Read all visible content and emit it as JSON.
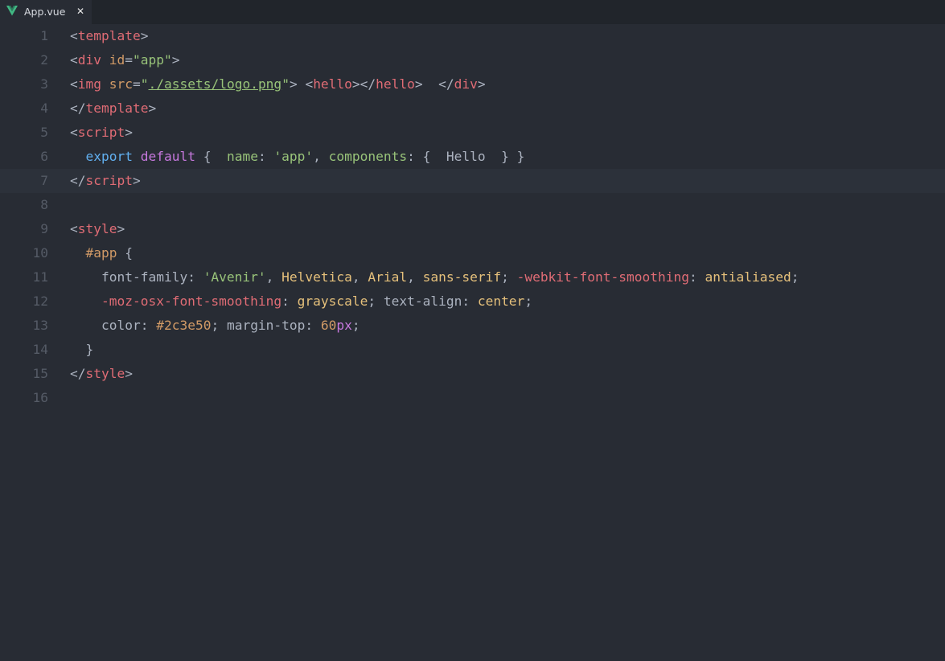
{
  "tab": {
    "title": "App.vue",
    "close_label": "✕",
    "icon": "vue-icon",
    "icon_color": "#41b883"
  },
  "editor": {
    "active_line": 7,
    "lines": [
      {
        "number": "1",
        "tokens": [
          {
            "t": "<",
            "c": "punct"
          },
          {
            "t": "template",
            "c": "tag"
          },
          {
            "t": ">",
            "c": "punct"
          }
        ]
      },
      {
        "number": "2",
        "tokens": [
          {
            "t": "<",
            "c": "punct"
          },
          {
            "t": "div",
            "c": "tag"
          },
          {
            "t": " ",
            "c": "plain"
          },
          {
            "t": "id",
            "c": "attr"
          },
          {
            "t": "=",
            "c": "punct"
          },
          {
            "t": "\"app\"",
            "c": "string"
          },
          {
            "t": ">",
            "c": "punct"
          }
        ]
      },
      {
        "number": "3",
        "tokens": [
          {
            "t": "<",
            "c": "punct"
          },
          {
            "t": "img",
            "c": "tag"
          },
          {
            "t": " ",
            "c": "plain"
          },
          {
            "t": "src",
            "c": "attr"
          },
          {
            "t": "=",
            "c": "punct"
          },
          {
            "t": "\"",
            "c": "string"
          },
          {
            "t": "./assets/logo.png",
            "c": "url"
          },
          {
            "t": "\"",
            "c": "string"
          },
          {
            "t": "> ",
            "c": "punct"
          },
          {
            "t": "<",
            "c": "punct"
          },
          {
            "t": "hello",
            "c": "tag"
          },
          {
            "t": "></",
            "c": "punct"
          },
          {
            "t": "hello",
            "c": "tag"
          },
          {
            "t": ">  </",
            "c": "punct"
          },
          {
            "t": "div",
            "c": "tag"
          },
          {
            "t": ">",
            "c": "punct"
          }
        ]
      },
      {
        "number": "4",
        "tokens": [
          {
            "t": "</",
            "c": "punct"
          },
          {
            "t": "template",
            "c": "tag"
          },
          {
            "t": ">",
            "c": "punct"
          }
        ]
      },
      {
        "number": "5",
        "tokens": [
          {
            "t": "<",
            "c": "punct"
          },
          {
            "t": "script",
            "c": "tag"
          },
          {
            "t": ">",
            "c": "punct"
          }
        ]
      },
      {
        "number": "6",
        "tokens": [
          {
            "t": "  ",
            "c": "plain"
          },
          {
            "t": "export",
            "c": "export"
          },
          {
            "t": " ",
            "c": "plain"
          },
          {
            "t": "default",
            "c": "keyword"
          },
          {
            "t": " {  ",
            "c": "plain"
          },
          {
            "t": "name",
            "c": "prop"
          },
          {
            "t": ": ",
            "c": "plain"
          },
          {
            "t": "'app'",
            "c": "string"
          },
          {
            "t": ", ",
            "c": "plain"
          },
          {
            "t": "components",
            "c": "prop"
          },
          {
            "t": ": {  Hello  } }",
            "c": "plain"
          }
        ]
      },
      {
        "number": "7",
        "tokens": [
          {
            "t": "</",
            "c": "punct"
          },
          {
            "t": "script",
            "c": "tag"
          },
          {
            "t": ">",
            "c": "punct"
          }
        ]
      },
      {
        "number": "8",
        "tokens": []
      },
      {
        "number": "9",
        "tokens": [
          {
            "t": "<",
            "c": "punct"
          },
          {
            "t": "style",
            "c": "tag"
          },
          {
            "t": ">",
            "c": "punct"
          }
        ]
      },
      {
        "number": "10",
        "tokens": [
          {
            "t": "  ",
            "c": "plain"
          },
          {
            "t": "#app",
            "c": "selector"
          },
          {
            "t": " {",
            "c": "plain"
          }
        ]
      },
      {
        "number": "11",
        "tokens": [
          {
            "t": "    ",
            "c": "plain"
          },
          {
            "t": "font-family",
            "c": "cssprop"
          },
          {
            "t": ": ",
            "c": "plain"
          },
          {
            "t": "'Avenir'",
            "c": "string"
          },
          {
            "t": ", ",
            "c": "plain"
          },
          {
            "t": "Helvetica",
            "c": "value"
          },
          {
            "t": ", ",
            "c": "plain"
          },
          {
            "t": "Arial",
            "c": "value"
          },
          {
            "t": ", ",
            "c": "plain"
          },
          {
            "t": "sans-serif",
            "c": "value"
          },
          {
            "t": "; ",
            "c": "plain"
          },
          {
            "t": "-webkit-font-smoothing",
            "c": "vendor"
          },
          {
            "t": ": ",
            "c": "plain"
          },
          {
            "t": "antialiased",
            "c": "value"
          },
          {
            "t": ";",
            "c": "plain"
          }
        ]
      },
      {
        "number": "12",
        "tokens": [
          {
            "t": "    ",
            "c": "plain"
          },
          {
            "t": "-moz-osx-font-smoothing",
            "c": "vendor"
          },
          {
            "t": ": ",
            "c": "plain"
          },
          {
            "t": "grayscale",
            "c": "value"
          },
          {
            "t": "; ",
            "c": "plain"
          },
          {
            "t": "text-align",
            "c": "cssprop"
          },
          {
            "t": ": ",
            "c": "plain"
          },
          {
            "t": "center",
            "c": "value"
          },
          {
            "t": ";",
            "c": "plain"
          }
        ]
      },
      {
        "number": "13",
        "tokens": [
          {
            "t": "    ",
            "c": "plain"
          },
          {
            "t": "color",
            "c": "cssprop"
          },
          {
            "t": ": ",
            "c": "plain"
          },
          {
            "t": "#2c3e50",
            "c": "hex"
          },
          {
            "t": "; ",
            "c": "plain"
          },
          {
            "t": "margin-top",
            "c": "cssprop"
          },
          {
            "t": ": ",
            "c": "plain"
          },
          {
            "t": "60",
            "c": "number"
          },
          {
            "t": "px",
            "c": "unit"
          },
          {
            "t": ";",
            "c": "plain"
          }
        ]
      },
      {
        "number": "14",
        "tokens": [
          {
            "t": "  }",
            "c": "plain"
          }
        ]
      },
      {
        "number": "15",
        "tokens": [
          {
            "t": "</",
            "c": "punct"
          },
          {
            "t": "style",
            "c": "tag"
          },
          {
            "t": ">",
            "c": "punct"
          }
        ]
      },
      {
        "number": "16",
        "tokens": []
      }
    ]
  }
}
